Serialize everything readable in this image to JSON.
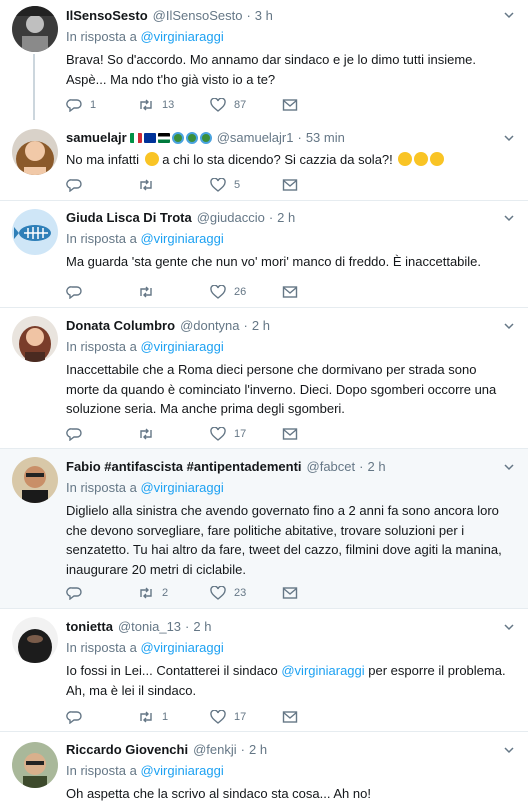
{
  "reply_prefix": "In risposta a",
  "colors": {
    "link": "#1da1f2",
    "muted": "#657786",
    "border": "#e6ecf0",
    "highlight_bg": "#f5f8fa"
  },
  "tweets": [
    {
      "name": "IlSensoSesto",
      "handle": "@IlSensoSesto",
      "time": "3 h",
      "reply_to": "@virginiaraggi",
      "lines": [
        "Brava! So d'accordo. Mo annamo dar sindaco e je lo dimo tutti insieme.",
        "Aspè... Ma ndo t'ho già visto io a te?"
      ],
      "replies": "1",
      "retweets": "13",
      "likes": "87"
    },
    {
      "name": "samuelajr",
      "handle": "@samuelajr1",
      "time": "53 min",
      "text": "No ma infatti",
      "text_after": "a chi lo sta dicendo? Si cazzia da sola?!",
      "replies": "",
      "retweets": "",
      "likes": "5"
    },
    {
      "name": "Giuda Lisca Di Trota",
      "handle": "@giudaccio",
      "time": "2 h",
      "reply_to": "@virginiaraggi",
      "lines": [
        "Ma guarda 'sta gente che nun vo' mori' manco di freddo. È inaccettabile."
      ],
      "replies": "",
      "retweets": "",
      "likes": "26"
    },
    {
      "name": "Donata Columbro",
      "handle": "@dontyna",
      "time": "2 h",
      "reply_to": "@virginiaraggi",
      "lines": [
        "Inaccettabile che a Roma dieci persone che dormivano per strada sono",
        "morte da quando è cominciato l'inverno. Dieci. Dopo sgomberi occorre una",
        "soluzione seria. Ma anche prima degli sgomberi."
      ],
      "replies": "",
      "retweets": "",
      "likes": "17"
    },
    {
      "name": "Fabio #antifascista #antipentadementi",
      "handle": "@fabcet",
      "time": "2 h",
      "reply_to": "@virginiaraggi",
      "lines": [
        "Diglielo alla sinistra che avendo governato fino a 2 anni fa sono ancora loro",
        "che devono sorvegliare, fare politiche abitative, trovare soluzioni per i",
        "senzatetto. Tu hai altro da fare, tweet del cazzo, filmini dove agiti la manina,",
        "inaugurare 20 metri di ciclabile."
      ],
      "replies": "",
      "retweets": "2",
      "likes": "23"
    },
    {
      "name": "tonietta",
      "handle": "@tonia_13",
      "time": "2 h",
      "reply_to": "@virginiaraggi",
      "line1_pre": "Io fossi in Lei... Contatterei il sindaco",
      "line1_link": "@virginiaraggi",
      "line1_post": "per esporre il problema.",
      "line2": "Ah, ma è lei il sindaco.",
      "replies": "",
      "retweets": "1",
      "likes": "17"
    },
    {
      "name": "Riccardo Giovenchi",
      "handle": "@fenkji",
      "time": "2 h",
      "reply_to": "@virginiaraggi",
      "lines": [
        "Oh aspetta che la scrivo al sindaco sta cosa... Ah no!"
      ]
    }
  ]
}
